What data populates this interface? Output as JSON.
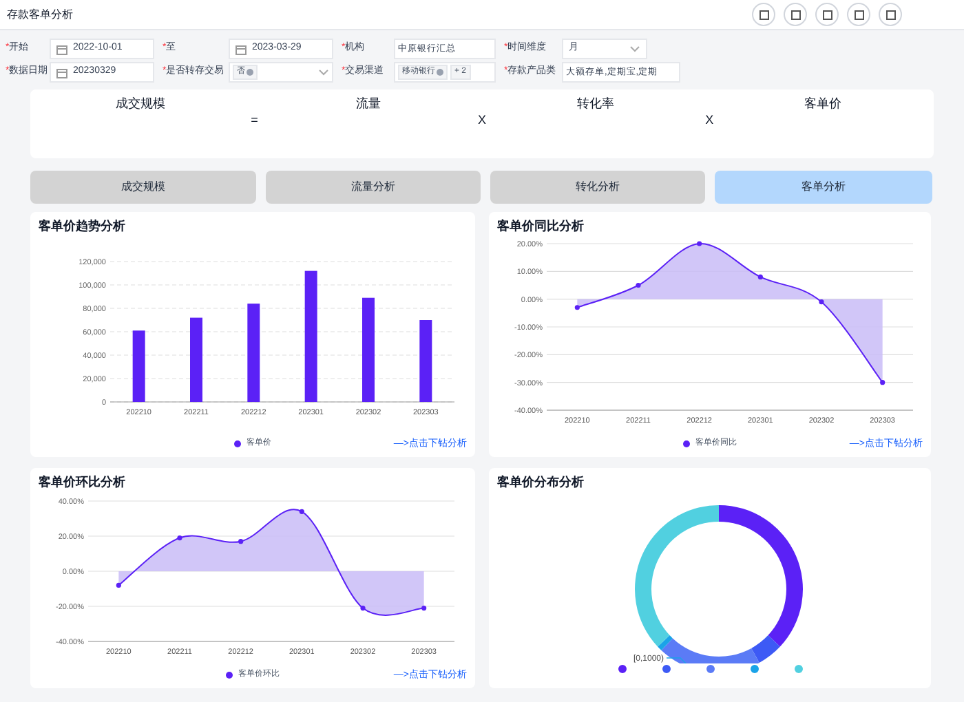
{
  "window": {
    "title": "存款客单分析"
  },
  "filters": [
    {
      "mark": "*",
      "label": "开始",
      "kind": "date",
      "value": "2022-10-01"
    },
    {
      "mark": "*",
      "label": "至",
      "kind": "date",
      "value": "2023-03-29"
    },
    {
      "mark": "*",
      "label": "机构",
      "kind": "text",
      "value": "中原银行汇总"
    },
    {
      "mark": "*",
      "label": "时间维度",
      "kind": "select",
      "value": "月"
    },
    {
      "mark": "*",
      "label": "数据日期",
      "kind": "date",
      "value": "20230329"
    },
    {
      "mark": "*",
      "label": "是否转存交易",
      "kind": "tags",
      "tags": [
        "否"
      ]
    },
    {
      "mark": "*",
      "label": "交易渠道",
      "kind": "tags",
      "tags": [
        "移动银行"
      ],
      "more": "+ 2"
    },
    {
      "mark": "*",
      "label": "存款产品类",
      "kind": "text",
      "value": "大额存单,定期宝,定期"
    }
  ],
  "formula": [
    {
      "kind": "term",
      "label": "成交规模"
    },
    {
      "kind": "op",
      "label": "="
    },
    {
      "kind": "term",
      "label": "流量"
    },
    {
      "kind": "op",
      "label": "X"
    },
    {
      "kind": "term",
      "label": "转化率"
    },
    {
      "kind": "op",
      "label": "X"
    },
    {
      "kind": "term",
      "label": "客单价"
    }
  ],
  "tabs": [
    {
      "label": "成交规模",
      "selected": false
    },
    {
      "label": "流量分析",
      "selected": false
    },
    {
      "label": "转化分析",
      "selected": false
    },
    {
      "label": "客单分析",
      "selected": true
    }
  ],
  "panels": [
    {
      "title": "客单价趋势分析",
      "link": "—>点击下钻分析",
      "chart_data": {
        "type": "bar",
        "categories": [
          "202210",
          "202211",
          "202212",
          "202301",
          "202302",
          "202303"
        ],
        "series": [
          {
            "name": "客单价",
            "color": "#5b21f6",
            "values": [
              61000,
              72000,
              84000,
              112000,
              89000,
              70000
            ]
          }
        ],
        "grid": true,
        "ylim": [
          0,
          120000
        ],
        "yticks": [
          0,
          {
            "value": 20000,
            "label": "20,000"
          },
          {
            "value": 40000,
            "label": "40,000"
          },
          {
            "value": 60000,
            "label": "60,000"
          },
          {
            "value": 80000,
            "label": "80,000"
          },
          {
            "value": 100000,
            "label": "100,000"
          },
          {
            "value": 120000,
            "label": "120,000"
          }
        ]
      }
    },
    {
      "title": "客单价同比分析",
      "link": "—>点击下钻分析",
      "chart_data": {
        "type": "area",
        "categories": [
          "202210",
          "202211",
          "202212",
          "202301",
          "202302",
          "202303"
        ],
        "series": [
          {
            "name": "客单价同比",
            "color": "#5b21f6",
            "values": [
              -3,
              5,
              20,
              8,
              -1,
              -30
            ]
          }
        ],
        "grid": true,
        "ylim": [
          -40,
          20
        ],
        "yticks": [
          {
            "value": 20,
            "label": "20.00%"
          },
          {
            "value": 10,
            "label": "10.00%"
          },
          {
            "value": 0,
            "label": "0.00%"
          },
          {
            "value": -10,
            "label": "-10.00%"
          },
          {
            "value": -20,
            "label": "-20.00%"
          },
          {
            "value": -30,
            "label": "-30.00%"
          },
          {
            "value": -40,
            "label": "-40.00%"
          }
        ]
      }
    },
    {
      "title": "客单价环比分析",
      "link": "—>点击下钻分析",
      "chart_data": {
        "type": "area",
        "categories": [
          "202210",
          "202211",
          "202212",
          "202301",
          "202302",
          "202303"
        ],
        "series": [
          {
            "name": "客单价环比",
            "color": "#5b21f6",
            "values": [
              -8,
              19,
              17,
              34,
              -21,
              -21
            ]
          }
        ],
        "grid": true,
        "ylim": [
          -40,
          40
        ],
        "yticks": [
          {
            "value": 40,
            "label": "40.00%"
          },
          {
            "value": 20,
            "label": "20.00%"
          },
          {
            "value": 0,
            "label": "0.00%"
          },
          {
            "value": -20,
            "label": "-20.00%"
          },
          {
            "value": -40,
            "label": "-40.00%"
          }
        ]
      }
    },
    {
      "title": "客单价分布分析",
      "donut_label": "[0,1000)"
    }
  ]
}
